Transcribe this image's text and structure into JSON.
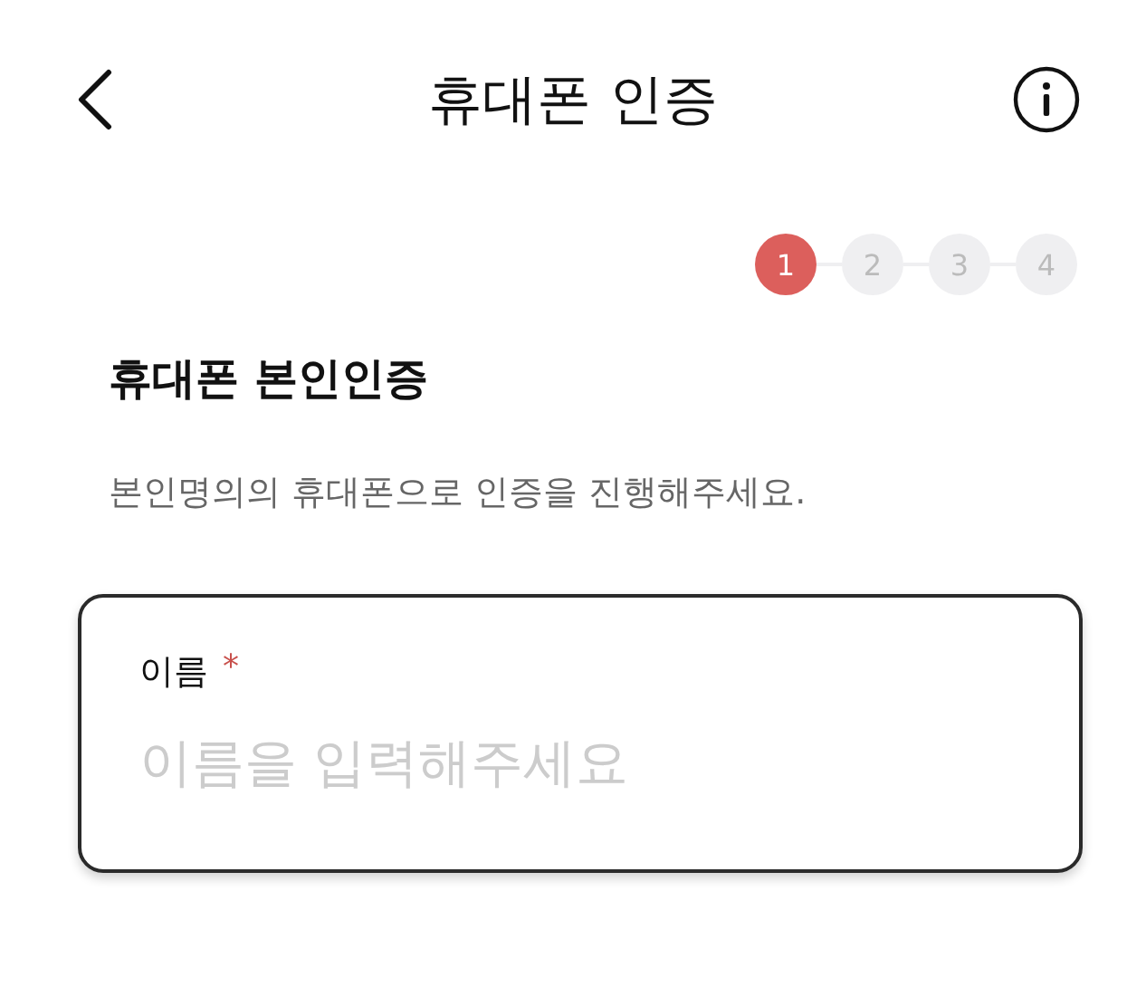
{
  "header": {
    "title": "휴대폰 인증"
  },
  "steps": [
    {
      "label": "1",
      "selected": true
    },
    {
      "label": "2",
      "selected": false
    },
    {
      "label": "3",
      "selected": false
    },
    {
      "label": "4",
      "selected": false
    }
  ],
  "heading": "휴대폰 본인인증",
  "description": "본인명의의 휴대폰으로 인증을 진행해주세요.",
  "field": {
    "label": "이름",
    "required_mark": "*",
    "placeholder": "이름을 입력해주세요"
  }
}
